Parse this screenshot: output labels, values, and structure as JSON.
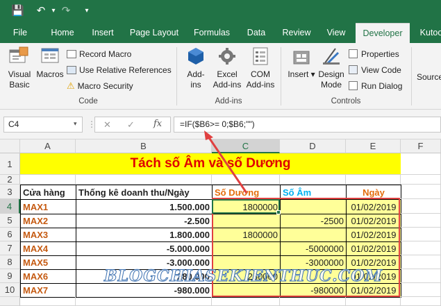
{
  "quick_access": {
    "save_icon": "💾",
    "undo_icon": "↶",
    "redo_icon": "↷",
    "more_icon": "▾"
  },
  "tabs": [
    "File",
    "Home",
    "Insert",
    "Page Layout",
    "Formulas",
    "Data",
    "Review",
    "View",
    "Developer",
    "Kutoo"
  ],
  "ribbon": {
    "code": {
      "visual_basic": "Visual\nBasic",
      "macros": "Macros",
      "record_macro": "Record Macro",
      "relative_refs": "Use Relative References",
      "macro_security": "Macro Security",
      "label": "Code"
    },
    "addins": {
      "addins": "Add-\nins",
      "excel_addins": "Excel\nAdd-ins",
      "com_addins": "COM\nAdd-ins",
      "label": "Add-ins"
    },
    "controls": {
      "insert": "Insert",
      "design_mode": "Design\nMode",
      "properties": "Properties",
      "view_code": "View Code",
      "run_dialog": "Run Dialog",
      "label": "Controls"
    },
    "source": "Source"
  },
  "formula_bar": {
    "name_box": "C4",
    "cancel": "✕",
    "enter": "✓",
    "fx": "fx",
    "formula": "=IF($B6>= 0;$B6;\"\")"
  },
  "columns": [
    "A",
    "B",
    "C",
    "D",
    "E",
    "F"
  ],
  "rows": [
    "1",
    "2",
    "3",
    "4",
    "5",
    "6",
    "7",
    "8",
    "9",
    "10"
  ],
  "sheet": {
    "title": "Tách số Âm và số Dương",
    "headers": {
      "a": "Cửa hàng",
      "b": "Thống kê doanh thu/Ngày",
      "c": "Số Dương",
      "d": "Số Âm",
      "e": "Ngày"
    },
    "header_colors": {
      "c": "#e46c0a",
      "d": "#00b0f0",
      "e": "#e46c0a"
    },
    "data": [
      {
        "store": "MAX1",
        "revenue": "1.500.000",
        "positive": "1800000",
        "negative": "",
        "date": "01/02/2019"
      },
      {
        "store": "MAX2",
        "revenue": "-2.500",
        "positive": "",
        "negative": "-2500",
        "date": "01/02/2019"
      },
      {
        "store": "MAX3",
        "revenue": "1.800.000",
        "positive": "1800000",
        "negative": "",
        "date": "01/02/2019"
      },
      {
        "store": "MAX4",
        "revenue": "-5.000.000",
        "positive": "",
        "negative": "-5000000",
        "date": "01/02/2019"
      },
      {
        "store": "MAX5",
        "revenue": "-3.000.000",
        "positive": "",
        "negative": "-3000000",
        "date": "01/02/2019"
      },
      {
        "store": "MAX6",
        "revenue": "280.000",
        "positive": "280000",
        "negative": "",
        "date": "01/02/2019"
      },
      {
        "store": "MAX7",
        "revenue": "-980.000",
        "positive": "",
        "negative": "-980000",
        "date": "01/02/2019"
      }
    ]
  },
  "watermark": "BLOGCHIASEKIENTHUC.COM"
}
